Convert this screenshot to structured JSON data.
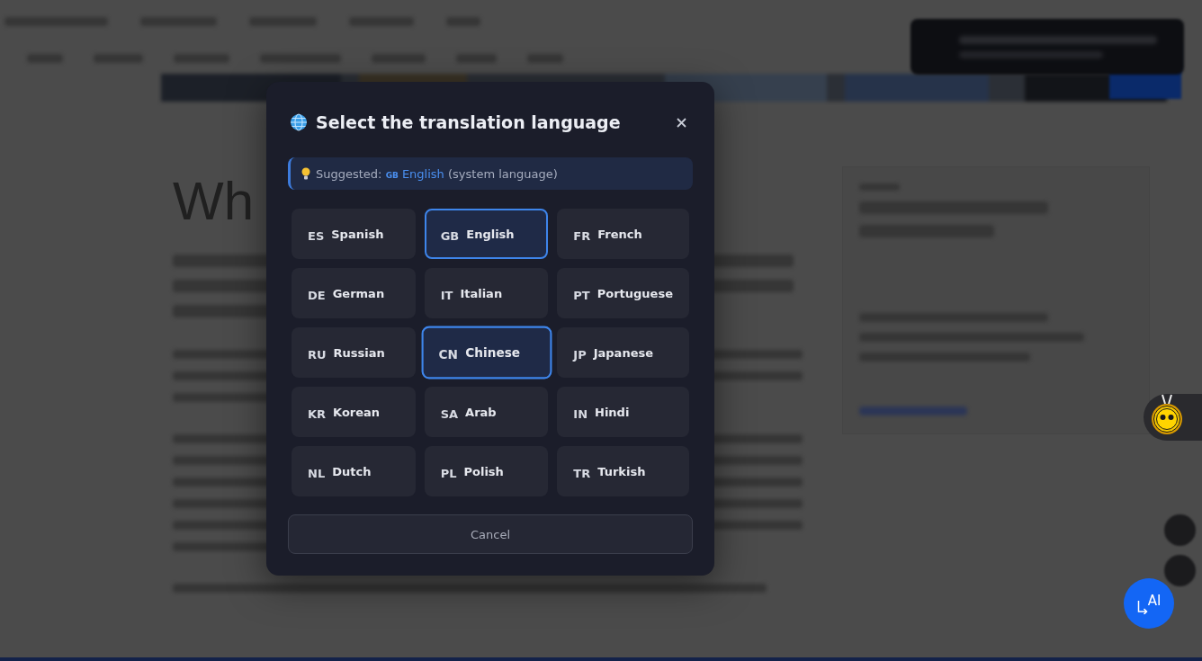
{
  "background": {
    "heading": "Wh"
  },
  "dialog": {
    "title": "Select the translation language",
    "suggestion": {
      "prefix": "Suggested:",
      "code": "GB",
      "language": "English",
      "note": "(system language)"
    },
    "languages": [
      {
        "code": "ES",
        "name": "Spanish",
        "selected": false,
        "hovered": false
      },
      {
        "code": "GB",
        "name": "English",
        "selected": true,
        "hovered": false
      },
      {
        "code": "FR",
        "name": "French",
        "selected": false,
        "hovered": false
      },
      {
        "code": "DE",
        "name": "German",
        "selected": false,
        "hovered": false
      },
      {
        "code": "IT",
        "name": "Italian",
        "selected": false,
        "hovered": false
      },
      {
        "code": "PT",
        "name": "Portuguese",
        "selected": false,
        "hovered": false
      },
      {
        "code": "RU",
        "name": "Russian",
        "selected": false,
        "hovered": false
      },
      {
        "code": "CN",
        "name": "Chinese",
        "selected": true,
        "hovered": true
      },
      {
        "code": "JP",
        "name": "Japanese",
        "selected": false,
        "hovered": false
      },
      {
        "code": "KR",
        "name": "Korean",
        "selected": false,
        "hovered": false
      },
      {
        "code": "SA",
        "name": "Arab",
        "selected": false,
        "hovered": false
      },
      {
        "code": "IN",
        "name": "Hindi",
        "selected": false,
        "hovered": false
      },
      {
        "code": "NL",
        "name": "Dutch",
        "selected": false,
        "hovered": false
      },
      {
        "code": "PL",
        "name": "Polish",
        "selected": false,
        "hovered": false
      },
      {
        "code": "TR",
        "name": "Turkish",
        "selected": false,
        "hovered": false
      }
    ],
    "cancel": "Cancel"
  },
  "ai_button": {
    "label": "AI"
  }
}
